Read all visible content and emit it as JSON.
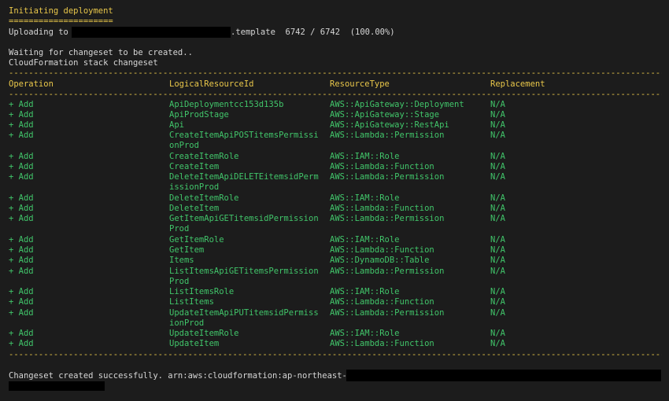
{
  "header": {
    "title": "Initiating deployment",
    "underline": "=====================",
    "upload_prefix": "Uploading to",
    "upload_suffix": ".template  6742 / 6742  (100.00%)"
  },
  "status": {
    "waiting": "Waiting for changeset to be created..",
    "changeset_title": "CloudFormation stack changeset"
  },
  "table": {
    "separator": "-------------------------------------------------------------------------------------------------------------------------------------------------------------------",
    "headers": {
      "operation": "Operation",
      "logical": "LogicalResourceId",
      "type": "ResourceType",
      "replacement": "Replacement"
    },
    "rows": [
      {
        "op": "+ Add",
        "id": "ApiDeploymentcc153d135b",
        "type": "AWS::ApiGateway::Deployment",
        "rep": "N/A"
      },
      {
        "op": "+ Add",
        "id": "ApiProdStage",
        "type": "AWS::ApiGateway::Stage",
        "rep": "N/A"
      },
      {
        "op": "+ Add",
        "id": "Api",
        "type": "AWS::ApiGateway::RestApi",
        "rep": "N/A"
      },
      {
        "op": "+ Add",
        "id": "CreateItemApiPOSTitemsPermissi",
        "id2": "onProd",
        "type": "AWS::Lambda::Permission",
        "rep": "N/A"
      },
      {
        "op": "+ Add",
        "id": "CreateItemRole",
        "type": "AWS::IAM::Role",
        "rep": "N/A"
      },
      {
        "op": "+ Add",
        "id": "CreateItem",
        "type": "AWS::Lambda::Function",
        "rep": "N/A"
      },
      {
        "op": "+ Add",
        "id": "DeleteItemApiDELETEitemsidPerm",
        "id2": "issionProd",
        "type": "AWS::Lambda::Permission",
        "rep": "N/A"
      },
      {
        "op": "+ Add",
        "id": "DeleteItemRole",
        "type": "AWS::IAM::Role",
        "rep": "N/A"
      },
      {
        "op": "+ Add",
        "id": "DeleteItem",
        "type": "AWS::Lambda::Function",
        "rep": "N/A"
      },
      {
        "op": "+ Add",
        "id": "GetItemApiGETitemsidPermission",
        "id2": "Prod",
        "type": "AWS::Lambda::Permission",
        "rep": "N/A"
      },
      {
        "op": "+ Add",
        "id": "GetItemRole",
        "type": "AWS::IAM::Role",
        "rep": "N/A"
      },
      {
        "op": "+ Add",
        "id": "GetItem",
        "type": "AWS::Lambda::Function",
        "rep": "N/A"
      },
      {
        "op": "+ Add",
        "id": "Items",
        "type": "AWS::DynamoDB::Table",
        "rep": "N/A"
      },
      {
        "op": "+ Add",
        "id": "ListItemsApiGETitemsPermission",
        "id2": "Prod",
        "type": "AWS::Lambda::Permission",
        "rep": "N/A"
      },
      {
        "op": "+ Add",
        "id": "ListItemsRole",
        "type": "AWS::IAM::Role",
        "rep": "N/A"
      },
      {
        "op": "+ Add",
        "id": "ListItems",
        "type": "AWS::Lambda::Function",
        "rep": "N/A"
      },
      {
        "op": "+ Add",
        "id": "UpdateItemApiPUTitemsidPermiss",
        "id2": "ionProd",
        "type": "AWS::Lambda::Permission",
        "rep": "N/A"
      },
      {
        "op": "+ Add",
        "id": "UpdateItemRole",
        "type": "AWS::IAM::Role",
        "rep": "N/A"
      },
      {
        "op": "+ Add",
        "id": "UpdateItem",
        "type": "AWS::Lambda::Function",
        "rep": "N/A"
      }
    ]
  },
  "footer": {
    "result": "Changeset created successfully. arn:aws:cloudformation:ap-northeast-1"
  },
  "colors": {
    "background": "#1c1c1c",
    "yellow": "#e9c74a",
    "green": "#41c56a",
    "text": "#d6d6d6",
    "redaction": "#000000"
  }
}
